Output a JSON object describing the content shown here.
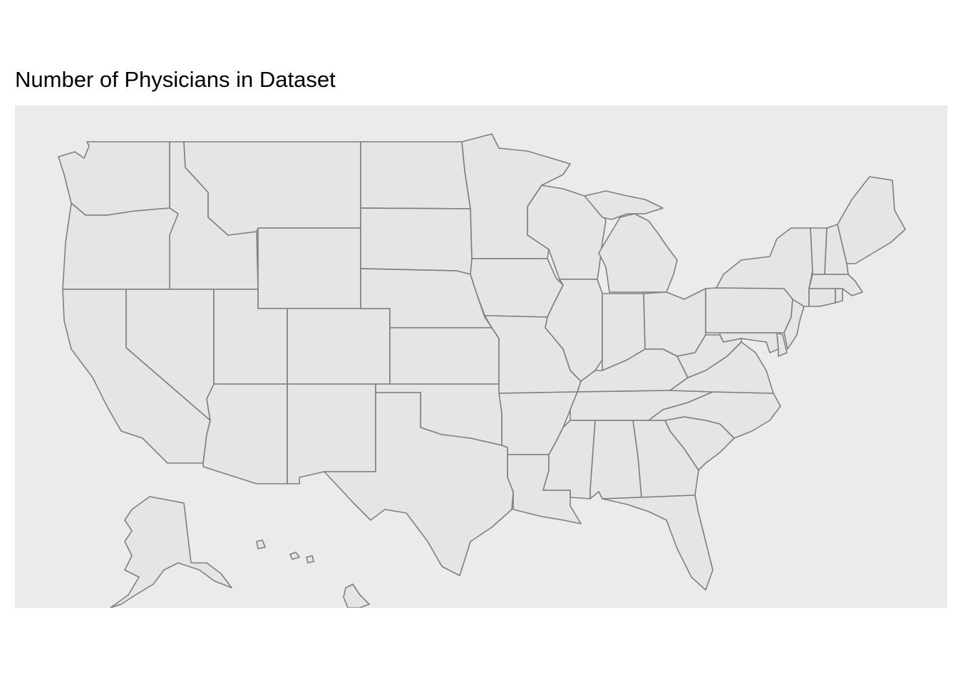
{
  "title": "Number of Physicians in Dataset",
  "map": {
    "region": "United States",
    "projection": "albers-like",
    "fill_color": "#e5e5e5",
    "border_color": "#7f7f7f",
    "panel_background": "#ebebeb",
    "legend": "none",
    "states": [
      "Washington",
      "Oregon",
      "California",
      "Idaho",
      "Nevada",
      "Montana",
      "Wyoming",
      "Utah",
      "Arizona",
      "Colorado",
      "New Mexico",
      "North Dakota",
      "South Dakota",
      "Nebraska",
      "Kansas",
      "Oklahoma",
      "Texas",
      "Minnesota",
      "Iowa",
      "Missouri",
      "Arkansas",
      "Louisiana",
      "Wisconsin",
      "Illinois",
      "Michigan",
      "Indiana",
      "Ohio",
      "Kentucky",
      "Tennessee",
      "Mississippi",
      "Alabama",
      "Georgia",
      "Florida",
      "South Carolina",
      "North Carolina",
      "Virginia",
      "West Virginia",
      "Maryland",
      "Delaware",
      "Pennsylvania",
      "New Jersey",
      "New York",
      "Connecticut",
      "Rhode Island",
      "Massachusetts",
      "Vermont",
      "New Hampshire",
      "Maine",
      "Alaska",
      "Hawaii"
    ]
  }
}
